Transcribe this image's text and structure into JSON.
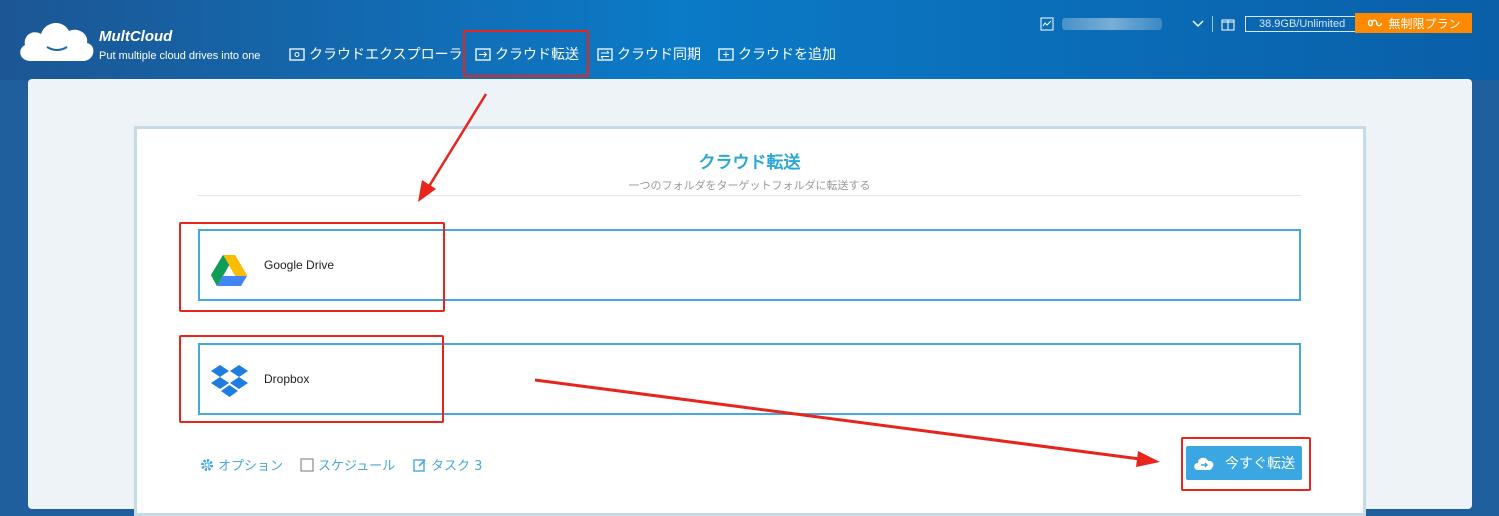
{
  "brand": {
    "name": "MultCloud",
    "tagline": "Put multiple cloud drives into one"
  },
  "nav": {
    "explorer": "クラウドエクスプローラ",
    "transfer": "クラウド転送",
    "sync": "クラウド同期",
    "add": "クラウドを追加"
  },
  "header_right": {
    "quota": "38.9GB/Unlimited",
    "plan_button": "無制限プラン"
  },
  "panel": {
    "title": "クラウド転送",
    "subtitle": "一つのフォルダをターゲットフォルダに転送する",
    "source": {
      "label": "Google Drive",
      "icon": "google-drive-icon"
    },
    "target": {
      "label": "Dropbox",
      "icon": "dropbox-icon"
    }
  },
  "options": {
    "option": "オプション",
    "schedule": "スケジュール",
    "task": "タスク 3"
  },
  "action": {
    "transfer_now": "今すぐ転送"
  },
  "colors": {
    "accent": "#3aa7e3",
    "highlight": "#e8251c",
    "plan": "#ff8a00",
    "title": "#2aa6d9"
  }
}
